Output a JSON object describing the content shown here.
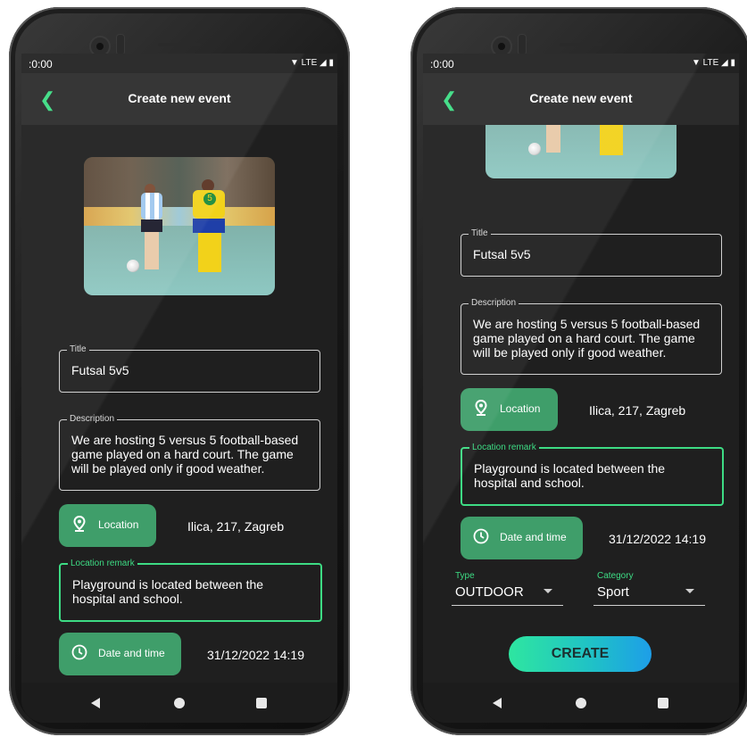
{
  "status": {
    "time": ":0:00",
    "icons": "▼ LTE ◢ ▮"
  },
  "appbar": {
    "title": "Create new event",
    "back_icon": "chevron-left-icon"
  },
  "form": {
    "title_label": "Title",
    "title_value": "Futsal 5v5",
    "description_label": "Description",
    "description_value": "We are hosting 5 versus 5 football-based game played on a hard court. The game will be played only if good weather.",
    "location_button": "Location",
    "location_value": "Ilica, 217, Zagreb",
    "location_remark_label": "Location remark",
    "location_remark_value": "Playground is located between the hospital and school.",
    "datetime_button": "Date and time",
    "datetime_value": "31/12/2022 14:19",
    "type_label": "Type",
    "type_value": "OUTDOOR",
    "category_label": "Category",
    "category_value": "Sport",
    "create_button": "CREATE"
  },
  "photo": {
    "jersey_number": "5"
  },
  "colors": {
    "accent": "#3ddc84",
    "button": "#3f9e6a",
    "background": "#1f1f1f",
    "appbar": "#2b2b2b"
  },
  "navbar": {
    "back_icon": "triangle-back-icon",
    "home_icon": "circle-home-icon",
    "recent_icon": "square-recent-icon"
  }
}
